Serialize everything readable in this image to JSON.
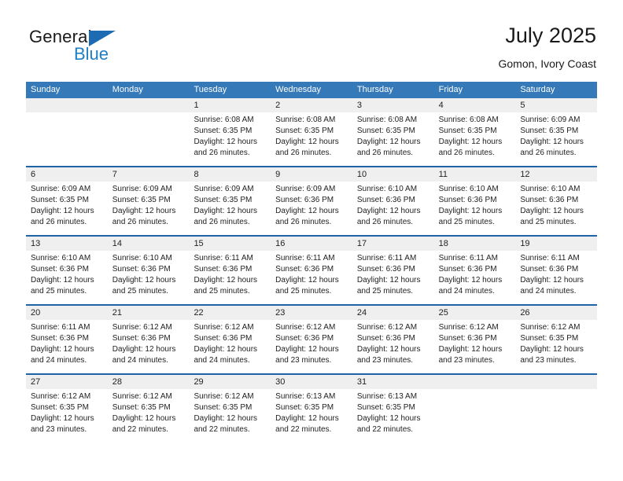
{
  "logo": {
    "word_one": "General",
    "word_two": "Blue",
    "triangle_color": "#1d6cb3",
    "blue_color": "#1f7ec4"
  },
  "header": {
    "title": "July 2025",
    "subtitle": "Gomon, Ivory Coast"
  },
  "theme": {
    "header_blue": "#3579b8",
    "separator_blue": "#1f63a8",
    "datebar_gray": "#efefef"
  },
  "weekdays": [
    "Sunday",
    "Monday",
    "Tuesday",
    "Wednesday",
    "Thursday",
    "Friday",
    "Saturday"
  ],
  "weeks": [
    {
      "days": [
        {
          "num": "",
          "lines": [
            "",
            "",
            "",
            ""
          ]
        },
        {
          "num": "",
          "lines": [
            "",
            "",
            "",
            ""
          ]
        },
        {
          "num": "1",
          "lines": [
            "Sunrise: 6:08 AM",
            "Sunset: 6:35 PM",
            "Daylight: 12 hours",
            "and 26 minutes."
          ]
        },
        {
          "num": "2",
          "lines": [
            "Sunrise: 6:08 AM",
            "Sunset: 6:35 PM",
            "Daylight: 12 hours",
            "and 26 minutes."
          ]
        },
        {
          "num": "3",
          "lines": [
            "Sunrise: 6:08 AM",
            "Sunset: 6:35 PM",
            "Daylight: 12 hours",
            "and 26 minutes."
          ]
        },
        {
          "num": "4",
          "lines": [
            "Sunrise: 6:08 AM",
            "Sunset: 6:35 PM",
            "Daylight: 12 hours",
            "and 26 minutes."
          ]
        },
        {
          "num": "5",
          "lines": [
            "Sunrise: 6:09 AM",
            "Sunset: 6:35 PM",
            "Daylight: 12 hours",
            "and 26 minutes."
          ]
        }
      ]
    },
    {
      "days": [
        {
          "num": "6",
          "lines": [
            "Sunrise: 6:09 AM",
            "Sunset: 6:35 PM",
            "Daylight: 12 hours",
            "and 26 minutes."
          ]
        },
        {
          "num": "7",
          "lines": [
            "Sunrise: 6:09 AM",
            "Sunset: 6:35 PM",
            "Daylight: 12 hours",
            "and 26 minutes."
          ]
        },
        {
          "num": "8",
          "lines": [
            "Sunrise: 6:09 AM",
            "Sunset: 6:35 PM",
            "Daylight: 12 hours",
            "and 26 minutes."
          ]
        },
        {
          "num": "9",
          "lines": [
            "Sunrise: 6:09 AM",
            "Sunset: 6:36 PM",
            "Daylight: 12 hours",
            "and 26 minutes."
          ]
        },
        {
          "num": "10",
          "lines": [
            "Sunrise: 6:10 AM",
            "Sunset: 6:36 PM",
            "Daylight: 12 hours",
            "and 26 minutes."
          ]
        },
        {
          "num": "11",
          "lines": [
            "Sunrise: 6:10 AM",
            "Sunset: 6:36 PM",
            "Daylight: 12 hours",
            "and 25 minutes."
          ]
        },
        {
          "num": "12",
          "lines": [
            "Sunrise: 6:10 AM",
            "Sunset: 6:36 PM",
            "Daylight: 12 hours",
            "and 25 minutes."
          ]
        }
      ]
    },
    {
      "days": [
        {
          "num": "13",
          "lines": [
            "Sunrise: 6:10 AM",
            "Sunset: 6:36 PM",
            "Daylight: 12 hours",
            "and 25 minutes."
          ]
        },
        {
          "num": "14",
          "lines": [
            "Sunrise: 6:10 AM",
            "Sunset: 6:36 PM",
            "Daylight: 12 hours",
            "and 25 minutes."
          ]
        },
        {
          "num": "15",
          "lines": [
            "Sunrise: 6:11 AM",
            "Sunset: 6:36 PM",
            "Daylight: 12 hours",
            "and 25 minutes."
          ]
        },
        {
          "num": "16",
          "lines": [
            "Sunrise: 6:11 AM",
            "Sunset: 6:36 PM",
            "Daylight: 12 hours",
            "and 25 minutes."
          ]
        },
        {
          "num": "17",
          "lines": [
            "Sunrise: 6:11 AM",
            "Sunset: 6:36 PM",
            "Daylight: 12 hours",
            "and 25 minutes."
          ]
        },
        {
          "num": "18",
          "lines": [
            "Sunrise: 6:11 AM",
            "Sunset: 6:36 PM",
            "Daylight: 12 hours",
            "and 24 minutes."
          ]
        },
        {
          "num": "19",
          "lines": [
            "Sunrise: 6:11 AM",
            "Sunset: 6:36 PM",
            "Daylight: 12 hours",
            "and 24 minutes."
          ]
        }
      ]
    },
    {
      "days": [
        {
          "num": "20",
          "lines": [
            "Sunrise: 6:11 AM",
            "Sunset: 6:36 PM",
            "Daylight: 12 hours",
            "and 24 minutes."
          ]
        },
        {
          "num": "21",
          "lines": [
            "Sunrise: 6:12 AM",
            "Sunset: 6:36 PM",
            "Daylight: 12 hours",
            "and 24 minutes."
          ]
        },
        {
          "num": "22",
          "lines": [
            "Sunrise: 6:12 AM",
            "Sunset: 6:36 PM",
            "Daylight: 12 hours",
            "and 24 minutes."
          ]
        },
        {
          "num": "23",
          "lines": [
            "Sunrise: 6:12 AM",
            "Sunset: 6:36 PM",
            "Daylight: 12 hours",
            "and 23 minutes."
          ]
        },
        {
          "num": "24",
          "lines": [
            "Sunrise: 6:12 AM",
            "Sunset: 6:36 PM",
            "Daylight: 12 hours",
            "and 23 minutes."
          ]
        },
        {
          "num": "25",
          "lines": [
            "Sunrise: 6:12 AM",
            "Sunset: 6:36 PM",
            "Daylight: 12 hours",
            "and 23 minutes."
          ]
        },
        {
          "num": "26",
          "lines": [
            "Sunrise: 6:12 AM",
            "Sunset: 6:35 PM",
            "Daylight: 12 hours",
            "and 23 minutes."
          ]
        }
      ]
    },
    {
      "days": [
        {
          "num": "27",
          "lines": [
            "Sunrise: 6:12 AM",
            "Sunset: 6:35 PM",
            "Daylight: 12 hours",
            "and 23 minutes."
          ]
        },
        {
          "num": "28",
          "lines": [
            "Sunrise: 6:12 AM",
            "Sunset: 6:35 PM",
            "Daylight: 12 hours",
            "and 22 minutes."
          ]
        },
        {
          "num": "29",
          "lines": [
            "Sunrise: 6:12 AM",
            "Sunset: 6:35 PM",
            "Daylight: 12 hours",
            "and 22 minutes."
          ]
        },
        {
          "num": "30",
          "lines": [
            "Sunrise: 6:13 AM",
            "Sunset: 6:35 PM",
            "Daylight: 12 hours",
            "and 22 minutes."
          ]
        },
        {
          "num": "31",
          "lines": [
            "Sunrise: 6:13 AM",
            "Sunset: 6:35 PM",
            "Daylight: 12 hours",
            "and 22 minutes."
          ]
        },
        {
          "num": "",
          "lines": [
            "",
            "",
            "",
            ""
          ]
        },
        {
          "num": "",
          "lines": [
            "",
            "",
            "",
            ""
          ]
        }
      ]
    }
  ]
}
